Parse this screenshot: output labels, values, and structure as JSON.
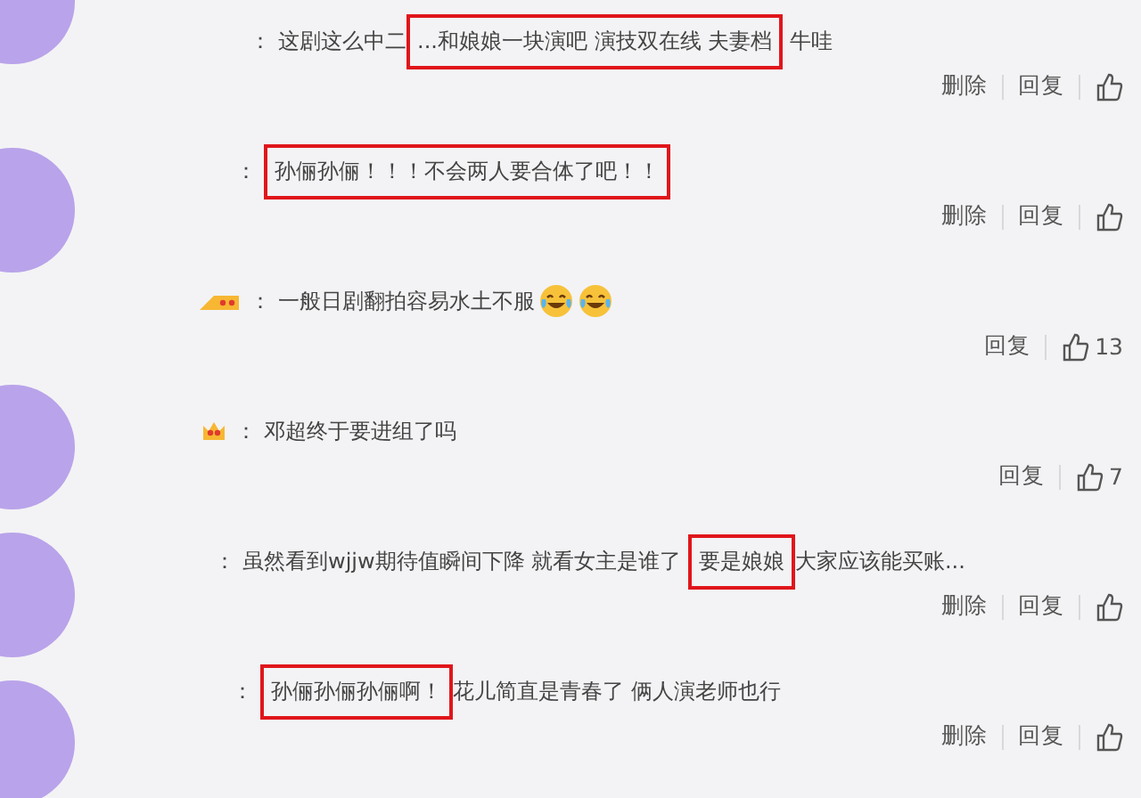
{
  "comments": [
    {
      "badge": false,
      "separator": "：",
      "segments": [
        {
          "kind": "text",
          "text": "这剧这么中二",
          "highlighted": false
        },
        {
          "kind": "text",
          "text": "...和娘娘一块演吧 演技双在线 夫妻档",
          "highlighted": true
        },
        {
          "kind": "text",
          "text": " 牛哇",
          "highlighted": false
        }
      ],
      "delete": "删除",
      "reply": "回复"
    },
    {
      "badge": false,
      "separator": "：",
      "segments": [
        {
          "kind": "text",
          "text": "孙俪孙俪！！！不会两人要合体了吧！！",
          "highlighted": true
        }
      ],
      "delete": "删除",
      "reply": "回复"
    },
    {
      "badge": true,
      "separator": "：",
      "segments": [
        {
          "kind": "text",
          "text": "一般日剧翻拍容易水土不服",
          "highlighted": false
        },
        {
          "kind": "emoji"
        },
        {
          "kind": "emoji"
        }
      ],
      "reply": "回复",
      "likes": "13"
    },
    {
      "badge": true,
      "separator": "：",
      "segments": [
        {
          "kind": "text",
          "text": "邓超终于要进组了吗",
          "highlighted": false
        }
      ],
      "reply": "回复",
      "likes": "7"
    },
    {
      "badge": false,
      "separator": "：",
      "segments": [
        {
          "kind": "text",
          "text": "虽然看到wjjw期待值瞬间下降 就看女主是谁了 ",
          "highlighted": false
        },
        {
          "kind": "text",
          "text": "要是娘娘",
          "highlighted": true
        },
        {
          "kind": "text",
          "text": "大家应该能买账...",
          "highlighted": false
        }
      ],
      "delete": "删除",
      "reply": "回复"
    },
    {
      "badge": false,
      "separator": "：",
      "segments": [
        {
          "kind": "text",
          "text": "孙俪孙俪孙俪啊！",
          "highlighted": true
        },
        {
          "kind": "text",
          "text": "花儿简直是青春了 俩人演老师也行",
          "highlighted": false
        }
      ],
      "delete": "删除",
      "reply": "回复"
    }
  ]
}
